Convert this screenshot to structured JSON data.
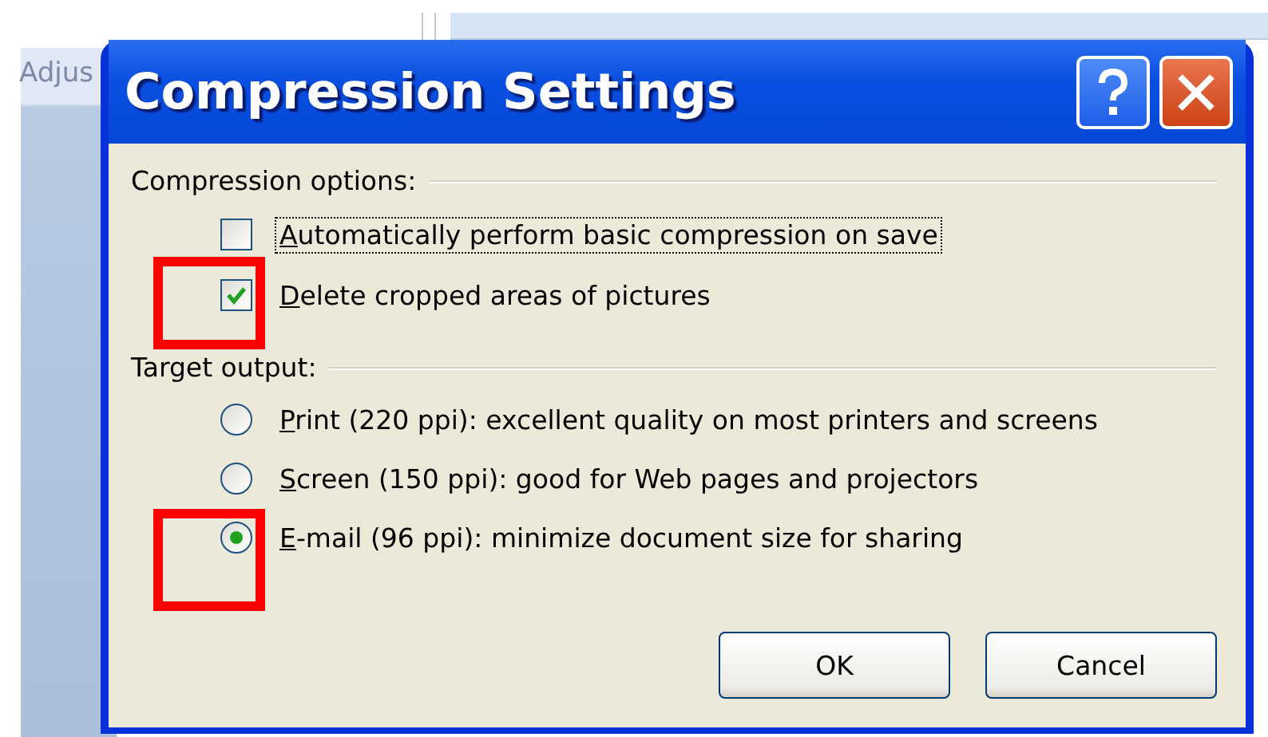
{
  "background": {
    "label": "Adjus"
  },
  "window": {
    "title": "Compression Settings"
  },
  "compression_options": {
    "label": "Compression options:",
    "options": [
      {
        "label": "Automatically perform basic compression on save",
        "checked": false,
        "focused": true,
        "highlighted": false
      },
      {
        "label": "Delete cropped areas of pictures",
        "checked": true,
        "focused": false,
        "highlighted": true
      }
    ]
  },
  "target_output": {
    "label": "Target output:",
    "options": [
      {
        "label": "Print (220 ppi): excellent quality on most printers and screens",
        "selected": false,
        "highlighted": false
      },
      {
        "label": "Screen (150 ppi): good for Web pages and projectors",
        "selected": false,
        "highlighted": false
      },
      {
        "label": "E-mail (96 ppi): minimize document size for sharing",
        "selected": true,
        "highlighted": true
      }
    ]
  },
  "buttons": [
    "OK",
    "Cancel"
  ]
}
